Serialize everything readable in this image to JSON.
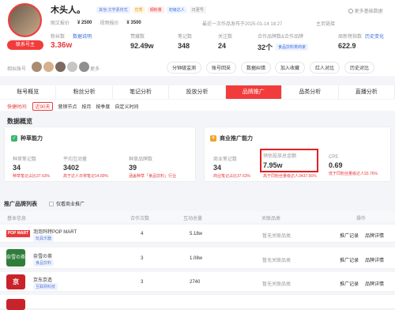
{
  "profile": {
    "name": "木头人。",
    "badges": [
      "其他-文学素材式",
      "优秀",
      "钢粉量",
      "初级达人"
    ],
    "updated_text": "日更号",
    "more_info": "更多基础数据",
    "price_image_label": "图文报价",
    "price_image": "¥ 2500",
    "price_video_label": "视频报价",
    "price_video": "¥ 3500",
    "fans_label": "粉丝数",
    "fans_value": "3.36w",
    "data_explain": "数据说明",
    "follow_label": "联系号主",
    "similar_label": "相似账号",
    "similar_more": "更多",
    "recent_update": "最近一次作品发布于2025-01-14 18:27",
    "copy_link_label": "主页链接"
  },
  "stats": [
    {
      "label": "赞藏数",
      "value": "92.49w"
    },
    {
      "label": "笔记数",
      "value": "348"
    },
    {
      "label": "关注数",
      "value": "24"
    },
    {
      "label": "合作品牌数&合作品牌",
      "value": "32个"
    },
    {
      "label": "周新榜指数",
      "value": "622.9"
    }
  ],
  "brand_tag": "食品饮料类商家",
  "history_label": "历史变化",
  "actions": [
    "分钟级监测",
    "账号回采",
    "数据纠错",
    "加入收藏",
    "红人对比",
    "历史对比"
  ],
  "tabs": [
    "账号概览",
    "粉丝分析",
    "笔记分析",
    "投放分析",
    "品牌推广",
    "品类分析",
    "直播分析"
  ],
  "active_tab": 4,
  "filters": {
    "time_label": "快捷时间:",
    "time_value": "近90天",
    "options": [
      "营销节点",
      "按月",
      "按季度",
      "自定义时间"
    ]
  },
  "overview_title": "数据概览",
  "seeding": {
    "title": "种草能力",
    "metrics": [
      {
        "label": "种草笔记数",
        "value": "34",
        "note": "种草笔记占比37.63%"
      },
      {
        "label": "平均互动量",
        "value": "3402",
        "note": "高于达人日常笔记14.89%"
      },
      {
        "label": "种草品牌数",
        "value": "39",
        "note": "涵盖种草「食品饮料」行业"
      }
    ]
  },
  "commercial": {
    "title": "商业推广能力",
    "metrics": [
      {
        "label": "商业笔记数",
        "value": "34",
        "note": "商业笔记占比37.63%"
      },
      {
        "label": "预估投放总金额",
        "value": "7.95w",
        "note": "高于同粉丝量级达人3437.56%"
      },
      {
        "label": "CPE",
        "value": "0.69",
        "note": "低于同粉丝量级达人93.76%"
      }
    ]
  },
  "brand_list": {
    "title": "推广品牌列表",
    "only_commercial": "仅看商业推广",
    "columns": [
      "基本信息",
      "合作次数",
      "互动总量",
      "关联品类",
      "操作"
    ],
    "rows": [
      {
        "logo": "POP MART",
        "name": "泡泡玛特POP MART",
        "tag": "玩具乐器",
        "count": "4",
        "interact": "5.18w",
        "category": "暂无关联品类",
        "op1": "推广记录",
        "op2": "品牌详情",
        "logo_bg": "#e8393a"
      },
      {
        "logo": "奈雪の茶",
        "name": "奈雪の茶",
        "tag": "食品饮料",
        "count": "3",
        "interact": "1.08w",
        "category": "暂无关联品类",
        "op1": "推广记录",
        "op2": "品牌详情",
        "logo_bg": "#2f7d3a"
      },
      {
        "logo": "京",
        "name": "京东京造",
        "tag": "互联网科技",
        "count": "3",
        "interact": "2740",
        "category": "暂无关联品类",
        "op1": "推广记录",
        "op2": "品牌详情",
        "logo_bg": "#c8232a"
      },
      {
        "logo": "",
        "name": "",
        "tag": "",
        "count": "",
        "interact": "",
        "category": "",
        "op1": "",
        "op2": "",
        "logo_bg": "#c8232a"
      }
    ]
  }
}
